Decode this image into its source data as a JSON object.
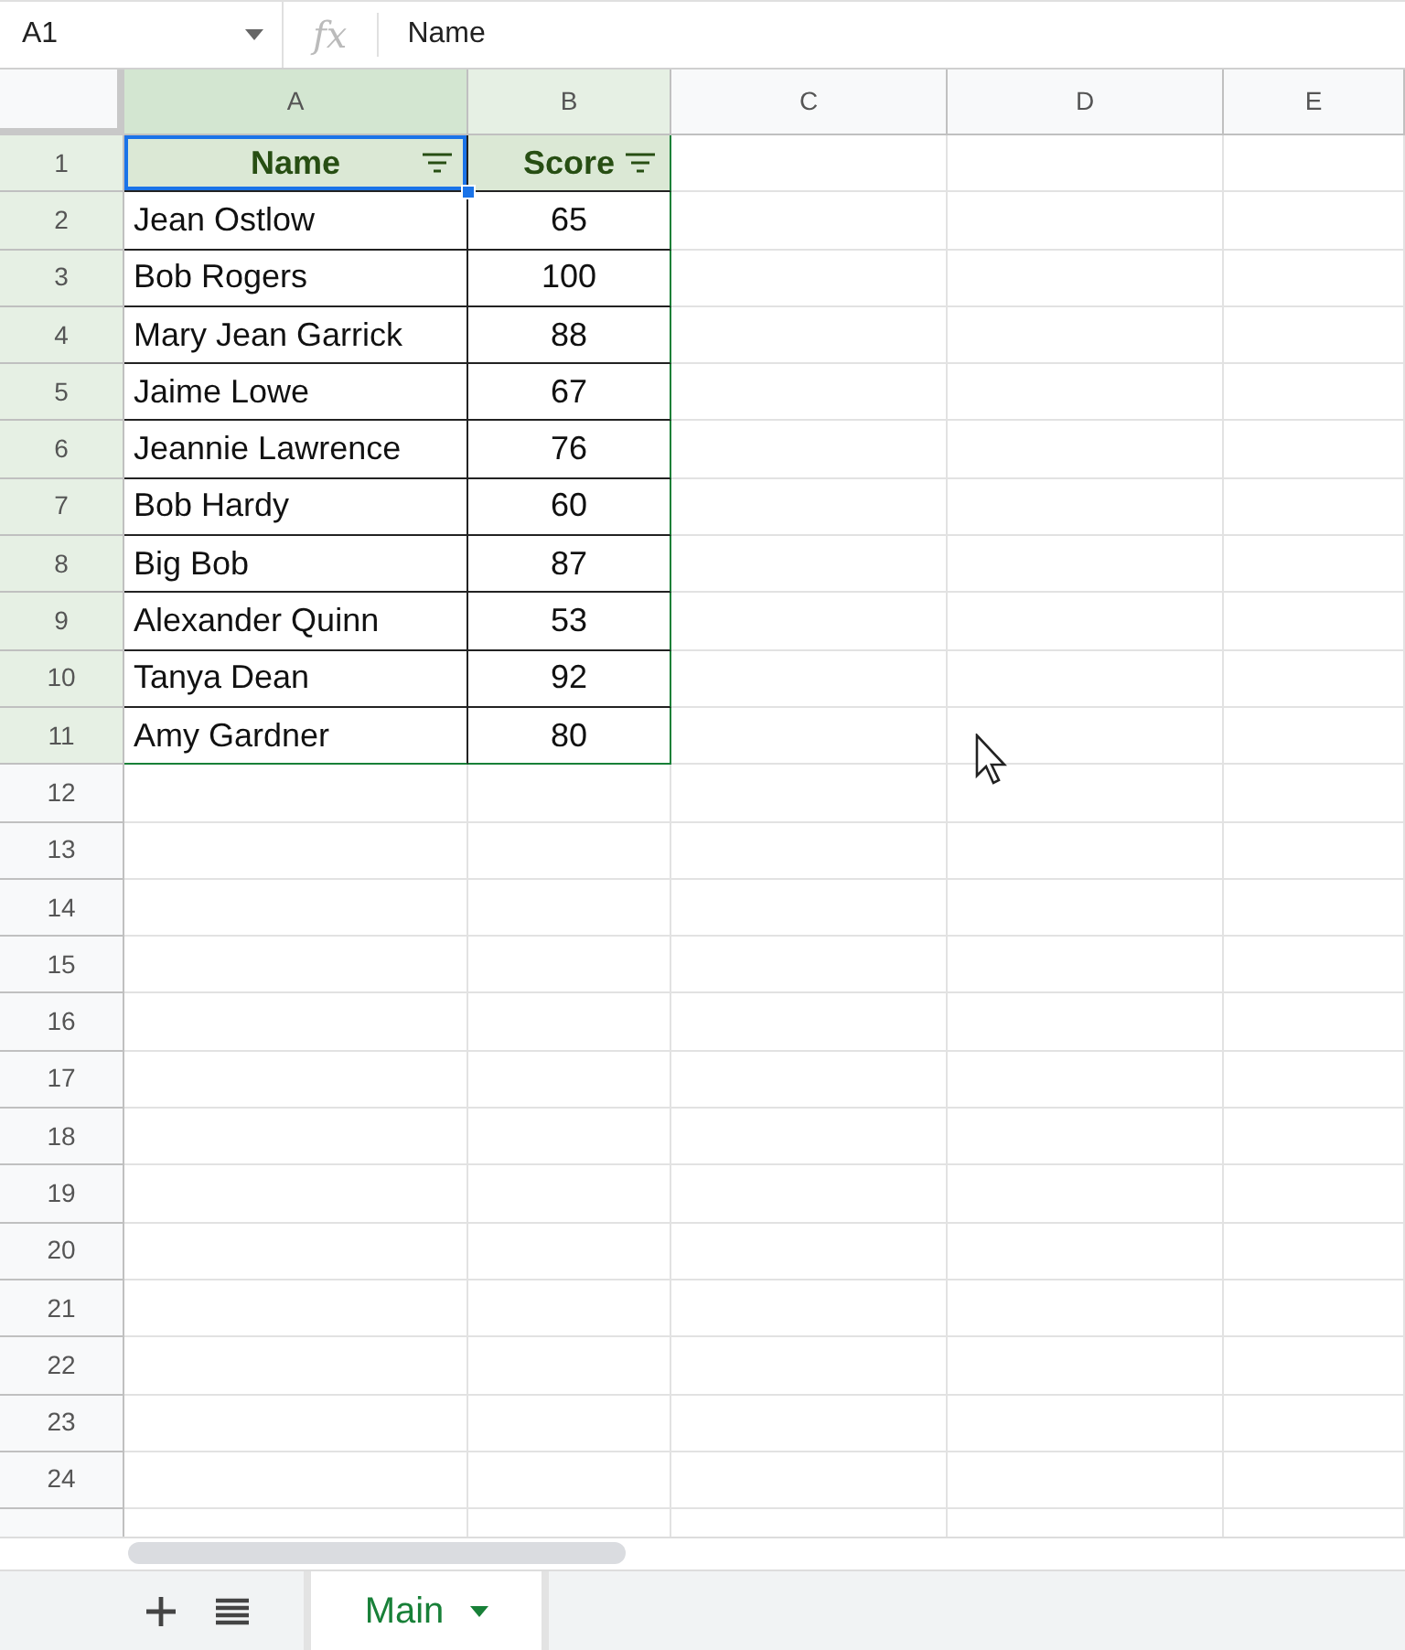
{
  "name_box": {
    "value": "A1"
  },
  "formula_bar": {
    "label": "fx",
    "value": "Name"
  },
  "columns": [
    {
      "label": "A",
      "highlighted": true
    },
    {
      "label": "B",
      "highlighted": true
    },
    {
      "label": "C",
      "highlighted": false
    },
    {
      "label": "D",
      "highlighted": false
    },
    {
      "label": "E",
      "highlighted": false
    }
  ],
  "row_numbers": [
    {
      "label": "1",
      "highlighted": true
    },
    {
      "label": "2",
      "highlighted": true
    },
    {
      "label": "3",
      "highlighted": true
    },
    {
      "label": "4",
      "highlighted": true
    },
    {
      "label": "5",
      "highlighted": true
    },
    {
      "label": "6",
      "highlighted": true
    },
    {
      "label": "7",
      "highlighted": true
    },
    {
      "label": "8",
      "highlighted": true
    },
    {
      "label": "9",
      "highlighted": true
    },
    {
      "label": "10",
      "highlighted": true
    },
    {
      "label": "11",
      "highlighted": true
    },
    {
      "label": "12",
      "highlighted": false
    },
    {
      "label": "13",
      "highlighted": false
    },
    {
      "label": "14",
      "highlighted": false
    },
    {
      "label": "15",
      "highlighted": false
    },
    {
      "label": "16",
      "highlighted": false
    },
    {
      "label": "17",
      "highlighted": false
    },
    {
      "label": "18",
      "highlighted": false
    },
    {
      "label": "19",
      "highlighted": false
    },
    {
      "label": "20",
      "highlighted": false
    },
    {
      "label": "21",
      "highlighted": false
    },
    {
      "label": "22",
      "highlighted": false
    },
    {
      "label": "23",
      "highlighted": false
    },
    {
      "label": "24",
      "highlighted": false
    }
  ],
  "table": {
    "header": [
      {
        "text": "Name",
        "filter": true,
        "selected": true
      },
      {
        "text": "Score",
        "filter": true,
        "selected": false
      }
    ],
    "rows": [
      [
        "Jean Ostlow",
        "65"
      ],
      [
        "Bob Rogers",
        "100"
      ],
      [
        "Mary Jean Garrick",
        "88"
      ],
      [
        "Jaime Lowe",
        "67"
      ],
      [
        "Jeannie Lawrence",
        "76"
      ],
      [
        "Bob Hardy",
        "60"
      ],
      [
        "Big Bob",
        "87"
      ],
      [
        "Alexander Quinn",
        "53"
      ],
      [
        "Tanya Dean",
        "92"
      ],
      [
        "Amy Gardner",
        "80"
      ]
    ]
  },
  "sheet_tabs": [
    {
      "label": "Main",
      "selected": true
    }
  ]
}
